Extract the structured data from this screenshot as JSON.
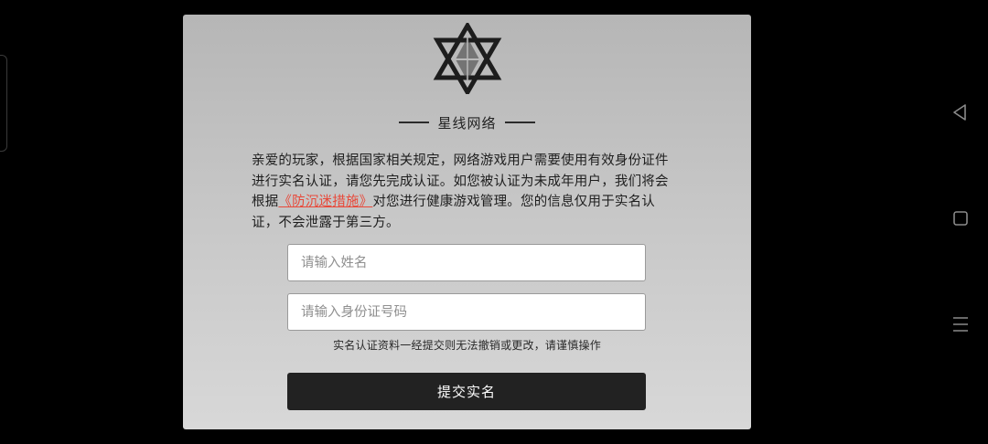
{
  "brand": {
    "name": "星线网络"
  },
  "notice": {
    "text_before": "亲爱的玩家，根据国家相关规定，网络游戏用户需要使用有效身份证件进行实名认证，请您先完成认证。如您被认证为未成年用户，我们将会根据",
    "link_text": "《防沉迷措施》",
    "text_after": "对您进行健康游戏管理。您的信息仅用于实名认证，不会泄露于第三方。"
  },
  "form": {
    "name_placeholder": "请输入姓名",
    "id_placeholder": "请输入身份证号码",
    "warning": "实名认证资料一经提交则无法撤销或更改，请谨慎操作",
    "submit_label": "提交实名"
  },
  "icons": {
    "logo": "hexagram-logo-icon",
    "back": "triangle-back-icon",
    "home": "square-home-icon",
    "menu": "hamburger-menu-icon"
  },
  "colors": {
    "link": "#e8493a",
    "button": "#222222",
    "nav_icon": "#8a8a8a"
  }
}
